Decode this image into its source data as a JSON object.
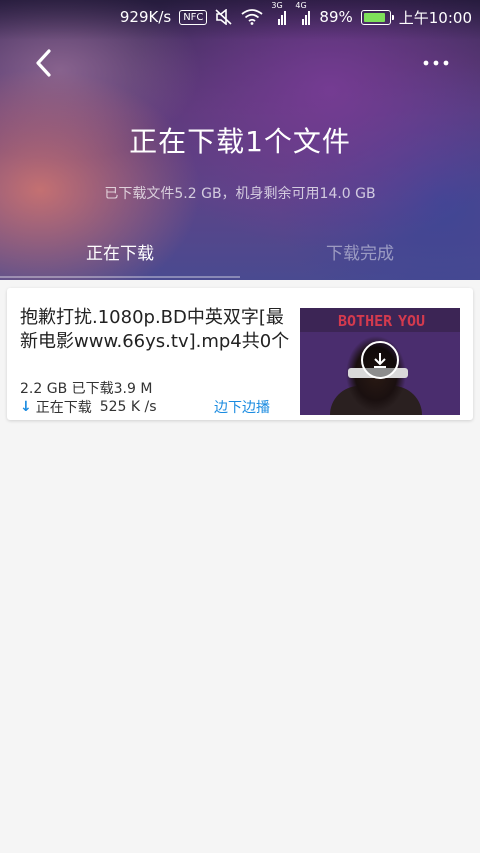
{
  "status_bar": {
    "network_speed": "929K/s",
    "nfc_label": "NFC",
    "net_3g": "3G",
    "net_4g": "4G",
    "battery_percent": "89%",
    "battery_level": 0.89,
    "time": "上午10:00"
  },
  "header": {
    "title": "正在下载1个文件",
    "subtitle": "已下载文件5.2 GB，机身剩余可用14.0 GB"
  },
  "tabs": [
    {
      "label": "正在下载",
      "active": true
    },
    {
      "label": "下载完成",
      "active": false
    }
  ],
  "download": {
    "file_name": "抱歉打扰.1080p.BD中英双字[最新电影www.66ys.tv].mp4共0个",
    "size_line": "2.2 GB  已下载3.9 M",
    "status": "正在下载",
    "speed": "525 K /s",
    "play_while_downloading": "边下边播",
    "thumbnail_text_left": "BOTHER",
    "thumbnail_text_right": "YOU"
  },
  "colors": {
    "accent": "#1a8be0",
    "battery_fill": "#7ee05a"
  }
}
